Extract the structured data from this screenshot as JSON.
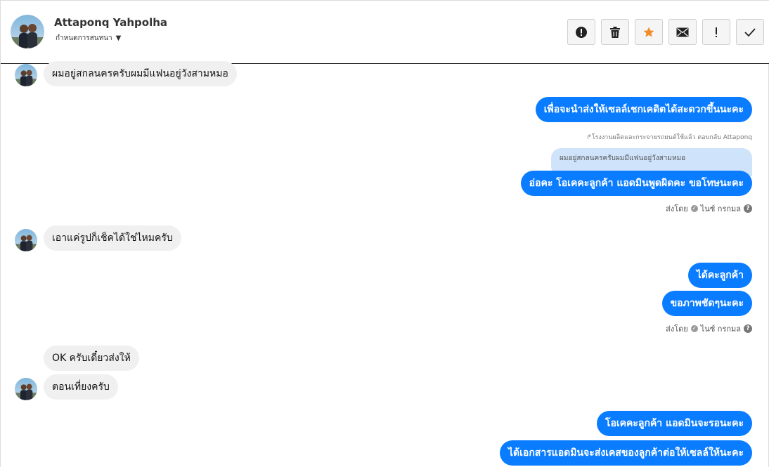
{
  "header": {
    "contact_name": "Attaponq Yahpolha",
    "subtitle": "กำหนดการสนทนา",
    "actions": [
      {
        "name": "report-button",
        "icon": "exclamation-circle-icon"
      },
      {
        "name": "delete-button",
        "icon": "trash-icon"
      },
      {
        "name": "star-button",
        "icon": "star-icon"
      },
      {
        "name": "mail-button",
        "icon": "envelope-icon"
      },
      {
        "name": "important-button",
        "icon": "exclamation-icon"
      },
      {
        "name": "done-button",
        "icon": "check-icon"
      }
    ]
  },
  "colors": {
    "outgoing_bubble": "#0a7cff",
    "incoming_bubble": "#f0f0f0",
    "star": "#f28c28",
    "quote_bubble": "#cfe3fb"
  },
  "messages": {
    "m1": "ผมอยู่สกลนครครับผมมีแฟนอยู่วังสามหมอ",
    "m2": "เพื่อจะนำส่งให้เซลล์เชกเคดิตได้สะดวกขึ้นนะคะ",
    "reply_meta": "โรงงานผลิตและกระจายรถยนต์ใช้แล้ว ตอบกลับ Attaponq",
    "reply_quote": "ผมอยู่สกลนครครับผมมีแฟนอยู่วังสามหมอ",
    "m3": "อ่อคะ โอเคคะลูกค้า แอดมินพูดผิดคะ ขอโทษนะคะ",
    "sent1_prefix": "ส่งโดย",
    "sent1_user": "ไนซ์ กรกมล",
    "m4": "เอาแค่รูปก็เช็คได้ใช่ไหมครับ",
    "m5": "ได้คะลูกค้า",
    "m6": "ขอภาพชัดๆนะคะ",
    "sent2_prefix": "ส่งโดย",
    "sent2_user": "ไนซ์ กรกมล",
    "m7": "OK ครับเดี๋ยวส่งให้",
    "m8": "ตอนเที่ยงครับ",
    "m9": "โอเคคะลูกค้า แอดมินจะรอนะคะ",
    "m10": "ได้เอกสารแอดมินจะส่งเคสของลูกค้าต่อให้เซลล์ให้นะคะ"
  }
}
